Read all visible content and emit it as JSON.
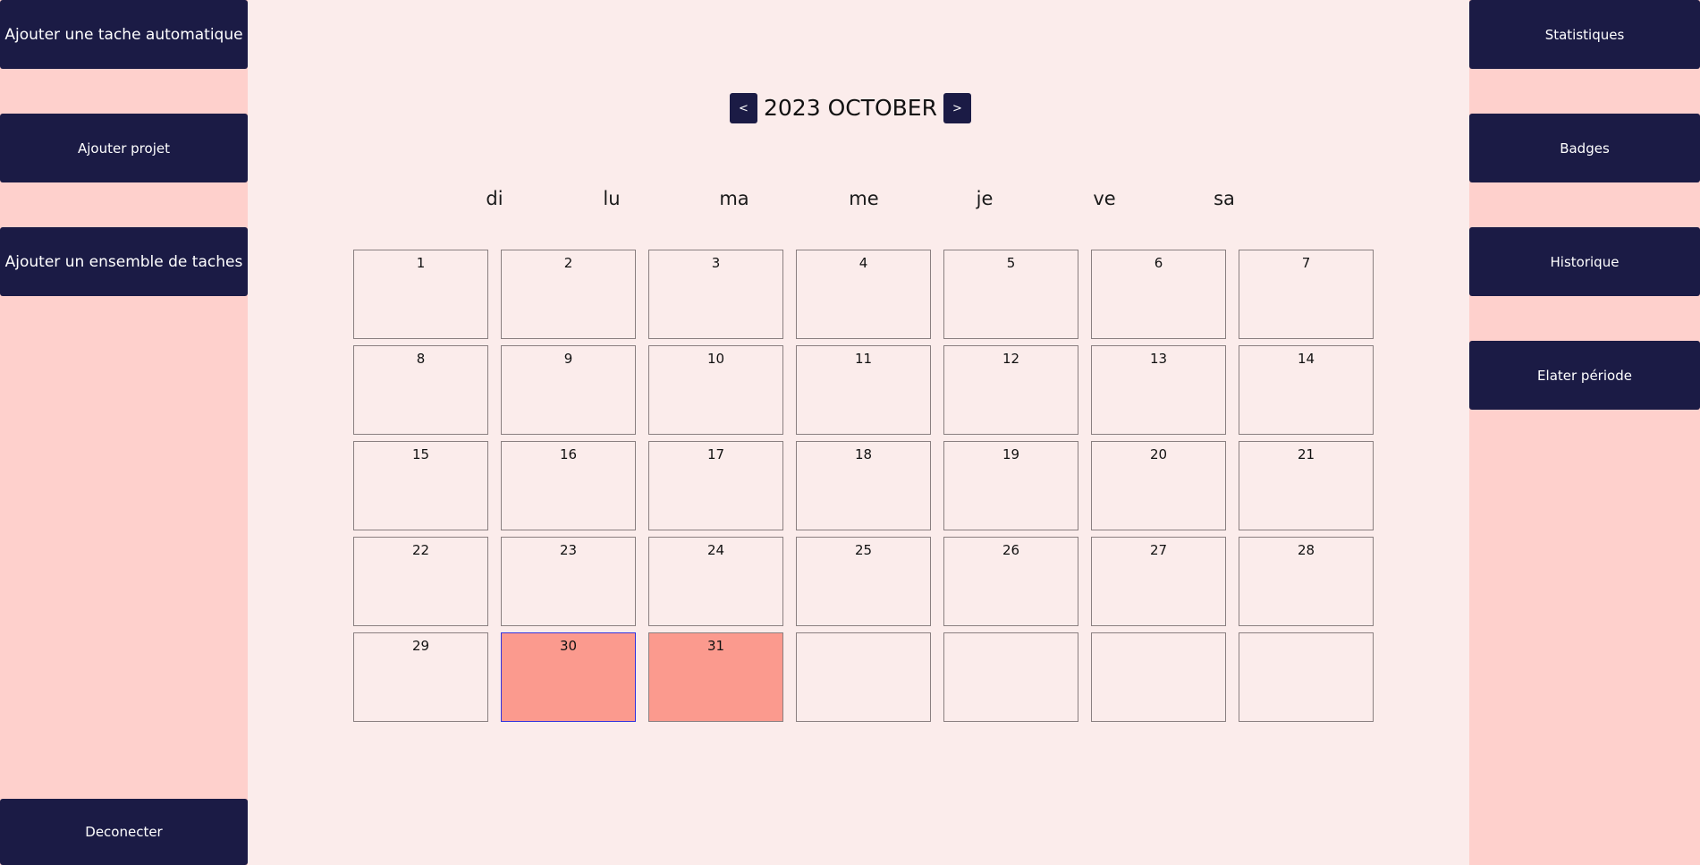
{
  "left_sidebar": {
    "buttons": [
      {
        "label": "Ajouter une tache automatique"
      },
      {
        "label": "Ajouter projet"
      },
      {
        "label": "Ajouter un ensemble de taches"
      }
    ],
    "logout_label": "Deconecter"
  },
  "right_sidebar": {
    "buttons": [
      {
        "label": "Statistiques"
      },
      {
        "label": "Badges"
      },
      {
        "label": "Historique"
      },
      {
        "label": "Elater période"
      }
    ]
  },
  "calendar": {
    "title": "2023 OCTOBER",
    "prev_label": "<",
    "next_label": ">",
    "weekdays": [
      "di",
      "lu",
      "ma",
      "me",
      "je",
      "ve",
      "sa"
    ],
    "days": [
      "1",
      "2",
      "3",
      "4",
      "5",
      "6",
      "7",
      "8",
      "9",
      "10",
      "11",
      "12",
      "13",
      "14",
      "15",
      "16",
      "17",
      "18",
      "19",
      "20",
      "21",
      "22",
      "23",
      "24",
      "25",
      "26",
      "27",
      "28",
      "29",
      "30",
      "31",
      "",
      "",
      "",
      ""
    ],
    "highlighted_days": [
      "30",
      "31"
    ],
    "selected_day": "30"
  },
  "colors": {
    "button_bg": "#1b1b45",
    "sidebar_bg": "#fed0cc",
    "main_bg": "#fbeceb",
    "highlight_bg": "#fb9a8e",
    "selected_border": "#3333dd"
  }
}
